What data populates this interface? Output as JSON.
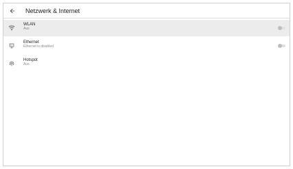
{
  "appbar": {
    "title": "Netzwerk & Internet"
  },
  "items": [
    {
      "label": "WLAN",
      "sub": "Aus",
      "icon": "wifi-icon",
      "toggle": "off"
    },
    {
      "label": "Ethernet",
      "sub": "Ethernet is disabled",
      "icon": "ethernet-icon",
      "toggle": "off"
    },
    {
      "label": "Hotspot",
      "sub": "Aus",
      "icon": "hotspot-icon"
    }
  ],
  "colors": {
    "selected_row": "#ececec",
    "icon": "#757575",
    "text_primary": "#212121",
    "text_secondary": "#8a8a8a"
  }
}
